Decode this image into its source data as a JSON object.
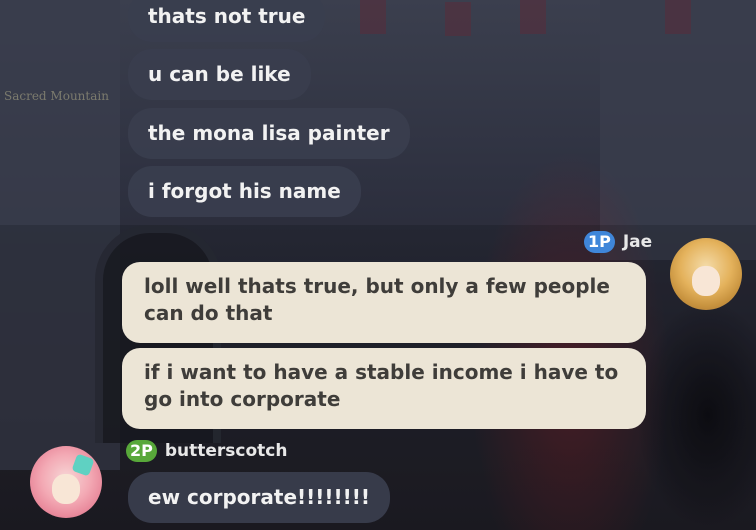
{
  "scene": {
    "location_label": "Sacred Mountain"
  },
  "messages_other": [
    {
      "text": "thats not true"
    },
    {
      "text": "u can be like"
    },
    {
      "text": "the mona lisa painter"
    },
    {
      "text": "i forgot his name"
    }
  ],
  "jae": {
    "badge": "1P",
    "name": "Jae",
    "messages": [
      "loll well thats true, but only a few people can do that",
      "if i want to have a stable income i have to go into corporate"
    ]
  },
  "butterscotch": {
    "badge": "2P",
    "name": "butterscotch",
    "messages": [
      "ew corporate!!!!!!!!"
    ]
  },
  "colors": {
    "bubble_dark": "#3a3e4e",
    "bubble_light": "#ece5d6",
    "badge_1p": "#3f86d9",
    "badge_2p": "#58a83a"
  }
}
